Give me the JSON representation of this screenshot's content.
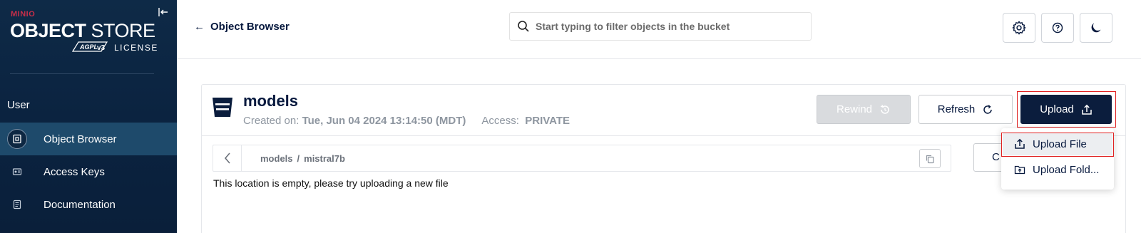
{
  "sidebar": {
    "brand": "MINIO",
    "title_bold": "OBJECT",
    "title_light": "STORE",
    "agpl": "AGPLv3",
    "license": "LICENSE",
    "section_label": "User",
    "items": [
      {
        "label": "Object Browser",
        "icon": "object-browser-icon",
        "active": true
      },
      {
        "label": "Access Keys",
        "icon": "access-keys-icon",
        "active": false
      },
      {
        "label": "Documentation",
        "icon": "documentation-icon",
        "active": false
      }
    ]
  },
  "header": {
    "back_label": "Object Browser",
    "search_placeholder": "Start typing to filter objects in the bucket",
    "buttons": [
      "settings",
      "help",
      "dark-mode"
    ]
  },
  "bucket": {
    "name": "models",
    "created_label": "Created on:",
    "created_value": "Tue, Jun 04 2024 13:14:50 (MDT)",
    "access_label": "Access:",
    "access_value": "PRIVATE",
    "rewind_label": "Rewind",
    "refresh_label": "Refresh",
    "upload_label": "Upload"
  },
  "breadcrumb": {
    "root": "models",
    "separator": "/",
    "current": "mistral7b"
  },
  "partial_button_label": "C",
  "empty_message": "This location is empty, please try uploading a new file",
  "upload_menu": {
    "items": [
      {
        "label": "Upload File",
        "highlighted": true
      },
      {
        "label": "Upload Fold..."
      }
    ]
  },
  "colors": {
    "sidebar_bg": "#0e2a47",
    "active_nav": "#1e4a6b",
    "primary": "#0b1d3d",
    "highlight_border": "#e02020",
    "brand_red": "#c72e49"
  }
}
